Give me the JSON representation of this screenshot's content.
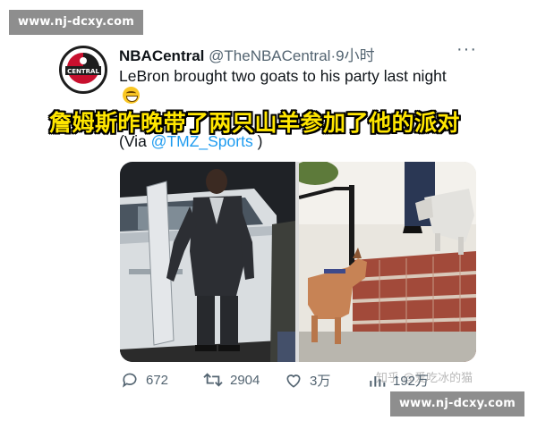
{
  "watermark": {
    "top": "www.nj-dcxy.com",
    "bottom": "www.nj-dcxy.com"
  },
  "tweet": {
    "display_name": "NBACentral",
    "handle": "@TheNBACentral",
    "separator": "·",
    "timestamp": "9小时",
    "more_icon": "more-dots-icon",
    "text": "LeBron brought two goats to his party last night",
    "caption": "詹姆斯昨晚带了两只山羊参加了他的派对",
    "via_prefix": "(Via ",
    "via_mention": "@TMZ_Sports",
    "via_suffix": " )",
    "avatar_text": "CENTRAL"
  },
  "actions": {
    "replies": "672",
    "retweets": "2904",
    "likes": "3万",
    "views": "192万"
  },
  "overlay_mark": "知乎 @爱吃冰的猫",
  "colors": {
    "accent": "#1d9bf0",
    "caption_fill": "#ffe600",
    "watermark_bg": "#8e8e8e",
    "muted": "#536471"
  }
}
